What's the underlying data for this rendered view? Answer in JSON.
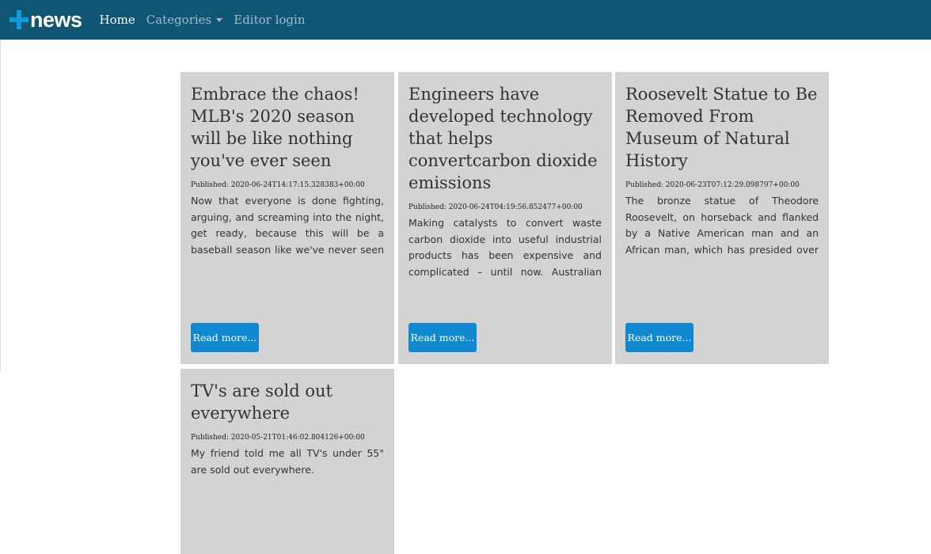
{
  "navbar": {
    "brand": "news",
    "links": [
      {
        "label": "Home",
        "active": true
      },
      {
        "label": "Categories",
        "dropdown": true
      },
      {
        "label": "Editor login"
      }
    ]
  },
  "articles": [
    {
      "title": "Embrace the chaos! MLB's 2020 season will be like nothing you've ever seen",
      "published": "Published: 2020-06-24T14:17:15.328383+00:00",
      "excerpt": "Now that everyone is done fighting, arguing, and screaming into the night, get ready, because this will be a baseball season like we've never seen before.",
      "button": "Read more..."
    },
    {
      "title": "Engineers have developed technology that helps convertcarbon dioxide emissions",
      "published": "Published: 2020-06-24T04:19:56.852477+00:00",
      "excerpt": "Making catalysts to convert waste carbon dioxide into useful industrial products has been expensive and complicated – until now. Australian engineers have shown it's",
      "button": "Read more..."
    },
    {
      "title": "Roosevelt Statue to Be Removed From Museum of Natural History",
      "published": "Published: 2020-06-23T07:12:29.098797+00:00",
      "excerpt": "The bronze statue of Theodore Roosevelt, on horseback and flanked by a Native American man and an African man, which has presided over the entrance to the",
      "button": "Read more..."
    },
    {
      "title": "TV's are sold out everywhere",
      "published": "Published: 2020-05-21T01:46:02.804126+00:00",
      "excerpt": "My friend told me all TV's under 55\" are sold out everywhere."
    }
  ]
}
